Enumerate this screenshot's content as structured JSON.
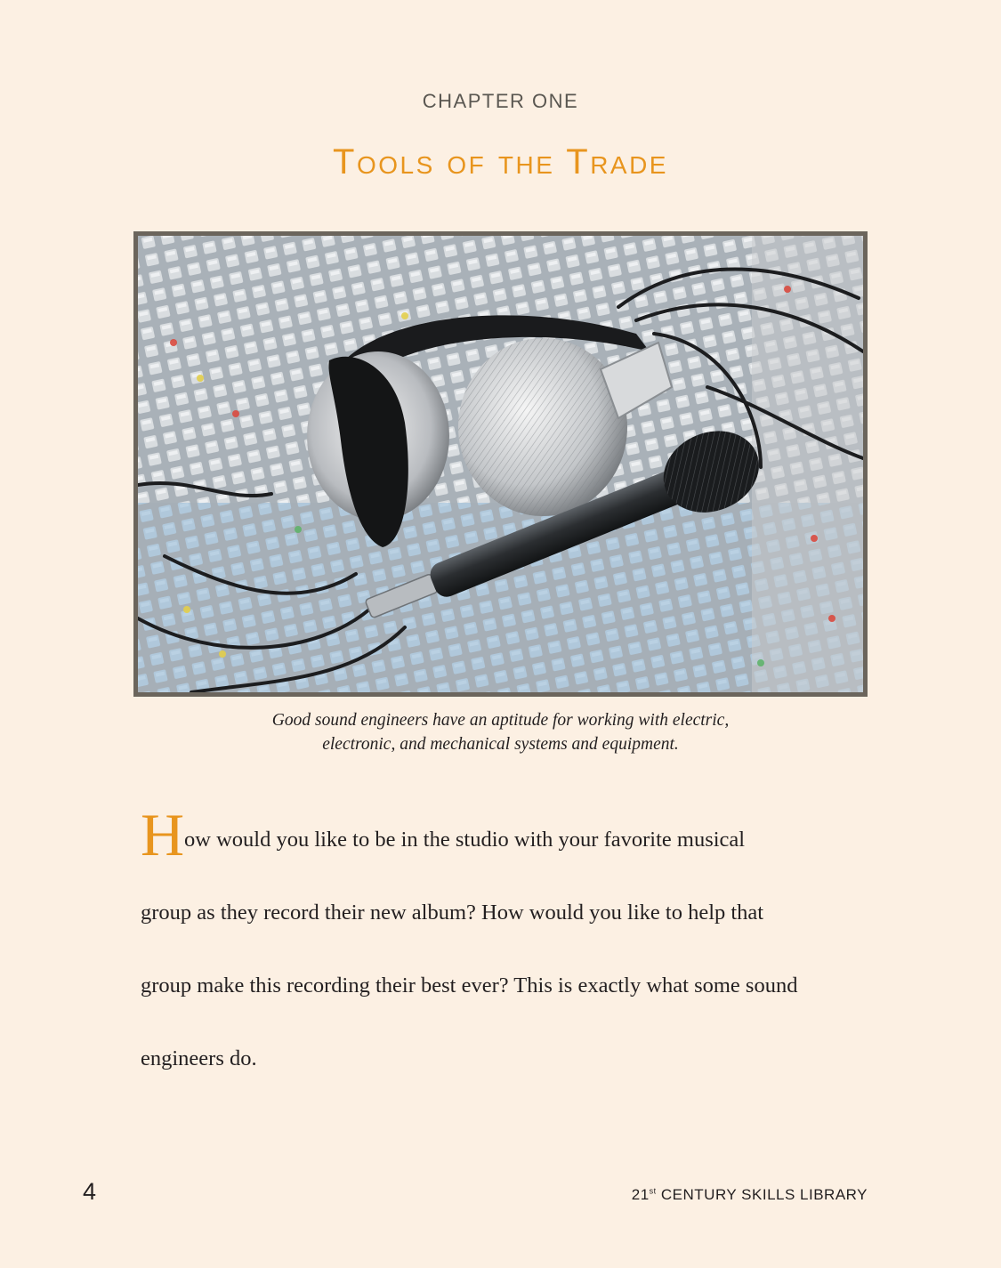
{
  "chapter": {
    "label": "CHAPTER ONE",
    "title": "Tools of the Trade"
  },
  "photo": {
    "subject": "headphones-and-microphone-on-mixing-console"
  },
  "caption": {
    "line1": "Good sound engineers have an aptitude for working with electric,",
    "line2": "electronic, and mechanical systems and equipment."
  },
  "body": {
    "drop_cap": "H",
    "line1": "ow would you like to be in the studio with your favorite musical",
    "line2": "group as they record their new album? How would you like to help that",
    "line3": "group make this recording their best ever? This is exactly what some sound",
    "line4": "engineers do."
  },
  "footer": {
    "page_number": "4",
    "series_prefix": "21",
    "series_superscript": "st",
    "series_suffix": " CENTURY SKILLS LIBRARY"
  },
  "colors": {
    "background": "#fcf0e3",
    "accent": "#e8951e",
    "frame": "#6b655c"
  }
}
